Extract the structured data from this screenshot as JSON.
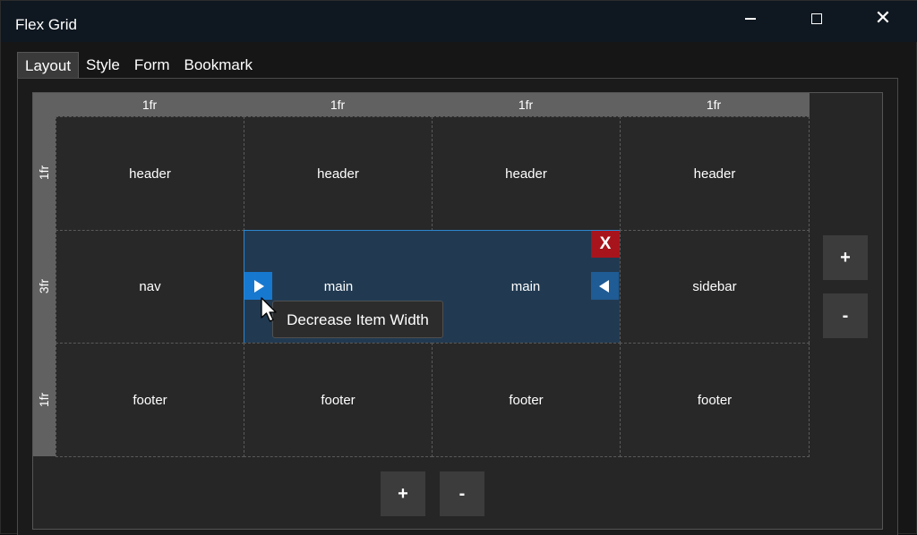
{
  "window": {
    "title": "Flex Grid",
    "controls": [
      "minimize",
      "maximize",
      "close"
    ]
  },
  "tabs": [
    {
      "label": "Layout",
      "active": true
    },
    {
      "label": "Style",
      "active": false
    },
    {
      "label": "Form",
      "active": false
    },
    {
      "label": "Bookmark",
      "active": false
    }
  ],
  "grid": {
    "columns": [
      "1fr",
      "1fr",
      "1fr",
      "1fr"
    ],
    "rows": [
      "1fr",
      "3fr",
      "1fr"
    ],
    "cells": [
      [
        "header",
        "header",
        "header",
        "header"
      ],
      [
        "nav",
        "main",
        "main",
        "sidebar"
      ],
      [
        "footer",
        "footer",
        "footer",
        "footer"
      ]
    ],
    "selected_item": {
      "label": "main",
      "span_columns": 2,
      "remove_label": "X"
    }
  },
  "tooltip": "Decrease Item Width",
  "row_controls": {
    "add_label": "+",
    "remove_label": "-"
  },
  "column_controls": {
    "add_label": "+",
    "remove_label": "-"
  },
  "colors": {
    "selection_border": "#2b86d0",
    "selection_fill": "#213a52",
    "remove_button": "#a8141c",
    "arrow_button": "#1778d0"
  }
}
